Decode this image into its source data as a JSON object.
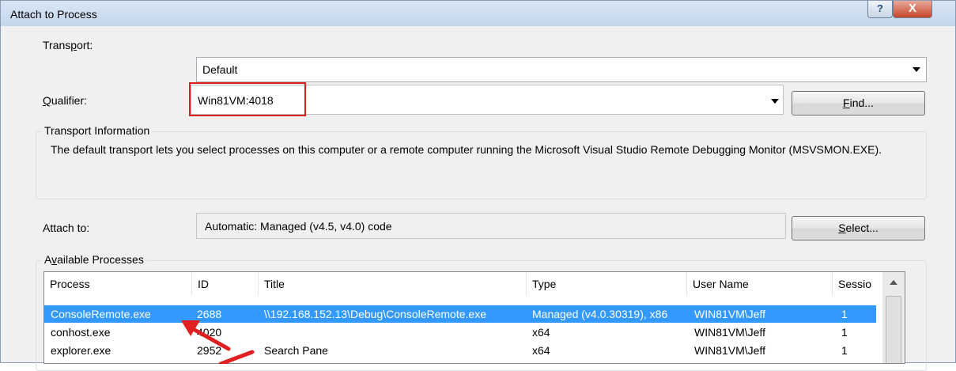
{
  "window": {
    "title": "Attach to Process",
    "help_glyph": "?",
    "close_glyph": "X"
  },
  "transport": {
    "label_pre": "Trans",
    "label_key": "p",
    "label_post": "ort:",
    "value": "Default"
  },
  "qualifier": {
    "label_key": "Q",
    "label_post": "ualifier:",
    "value": "Win81VM:4018"
  },
  "find_button": {
    "label_key": "F",
    "label_post": "ind..."
  },
  "transport_info": {
    "title": "Transport Information",
    "text": "The default transport lets you select processes on this computer or a remote computer running the Microsoft Visual Studio Remote Debugging Monitor (MSVSMON.EXE)."
  },
  "attach_to": {
    "label": "Attach to:",
    "value": "Automatic: Managed (v4.5, v4.0) code"
  },
  "select_button": {
    "label_key": "S",
    "label_post": "elect..."
  },
  "available_processes": {
    "title_pre": "A",
    "title_key": "v",
    "title_post": "ailable Processes",
    "columns": [
      "Process",
      "ID",
      "Title",
      "Type",
      "User Name",
      "Sessio"
    ],
    "rows": [
      {
        "process": "ConsoleRemote.exe",
        "id": "2688",
        "title": "\\\\192.168.152.13\\Debug\\ConsoleRemote.exe",
        "type": "Managed (v4.0.30319), x86",
        "user": "WIN81VM\\Jeff",
        "session": "1",
        "selected": true
      },
      {
        "process": "conhost.exe",
        "id": "4020",
        "title": "",
        "type": "x64",
        "user": "WIN81VM\\Jeff",
        "session": "1",
        "selected": false
      },
      {
        "process": "explorer.exe",
        "id": "2952",
        "title": "Search Pane",
        "type": "x64",
        "user": "WIN81VM\\Jeff",
        "session": "1",
        "selected": false
      }
    ]
  },
  "colors": {
    "selection": "#3399ff",
    "annotation": "#e02020"
  }
}
